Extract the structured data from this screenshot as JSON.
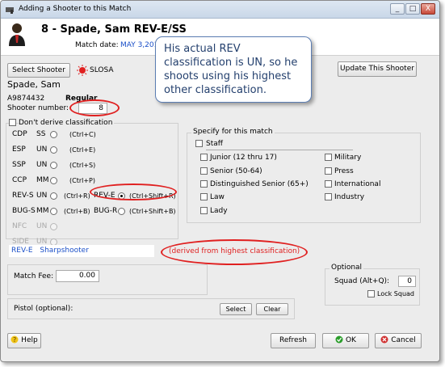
{
  "window": {
    "title": "Adding a Shooter to this Match",
    "min_label": "_",
    "max_label": "□",
    "close_label": "X"
  },
  "header": {
    "title": "8 - Spade, Sam   REV-E/SS",
    "date_label": "Match date:",
    "date": "MAY 3,2015"
  },
  "callout": {
    "text": "His actual REV classification is UN, so he shoots using his highest other classification."
  },
  "buttons": {
    "select_shooter": "Select Shooter",
    "slosa": "SLOSA",
    "update_shooter": "Update This Shooter",
    "select": "Select",
    "clear": "Clear",
    "help": "Help",
    "refresh": "Refresh",
    "ok": "OK",
    "cancel": "Cancel"
  },
  "shooter": {
    "name": "Spade, Sam",
    "id": "A9874432",
    "type": "Regular",
    "number_label": "Shooter number:",
    "number": "8",
    "dont_derive": "Don't derive classification"
  },
  "divisions": [
    {
      "code": "CDP",
      "class": "SS",
      "shortcut": "(Ctrl+C)",
      "selected": false,
      "enabled": true
    },
    {
      "code": "ESP",
      "class": "UN",
      "shortcut": "(Ctrl+E)",
      "selected": false,
      "enabled": true
    },
    {
      "code": "SSP",
      "class": "UN",
      "shortcut": "(Ctrl+S)",
      "selected": false,
      "enabled": true
    },
    {
      "code": "CCP",
      "class": "MM",
      "shortcut": "(Ctrl+P)",
      "selected": false,
      "enabled": true
    },
    {
      "code": "REV-S",
      "class": "UN",
      "shortcut": "(Ctrl+R)",
      "selected": false,
      "enabled": true
    },
    {
      "code": "BUG-S",
      "class": "MM",
      "shortcut": "(Ctrl+B)",
      "selected": false,
      "enabled": true
    },
    {
      "code": "NFC",
      "class": "UN",
      "shortcut": "",
      "selected": false,
      "enabled": false
    },
    {
      "code": "SIDE",
      "class": "UN",
      "shortcut": "",
      "selected": false,
      "enabled": false
    }
  ],
  "divisions_right": [
    {
      "code": "REV-E",
      "shortcut": "(Ctrl+Shift+R)",
      "selected": true
    },
    {
      "code": "BUG-R",
      "shortcut": "(Ctrl+Shift+B)",
      "selected": false
    }
  ],
  "specify": {
    "title": "Specify for this match",
    "staff": "Staff",
    "left": [
      "Junior (12 thru 17)",
      "Senior (50-64)",
      "Distinguished Senior (65+)",
      "Law",
      "Lady"
    ],
    "right": [
      "Military",
      "Press",
      "International",
      "Industry"
    ]
  },
  "derived": {
    "division": "REV-E",
    "classification": "Sharpshooter",
    "note": "(derived from highest classification)"
  },
  "fee": {
    "label": "Match Fee:",
    "value": "0.00"
  },
  "optional": {
    "title": "Optional",
    "squad_label": "Squad (Alt+Q):",
    "squad_value": "0",
    "lock_squad": "Lock Squad"
  },
  "pistol": {
    "label": "Pistol (optional):"
  },
  "colors": {
    "accent_blue": "#1a4fc8",
    "annotation_red": "#e02020",
    "ok_green": "#2a9d2a",
    "cancel_red": "#d03030"
  }
}
